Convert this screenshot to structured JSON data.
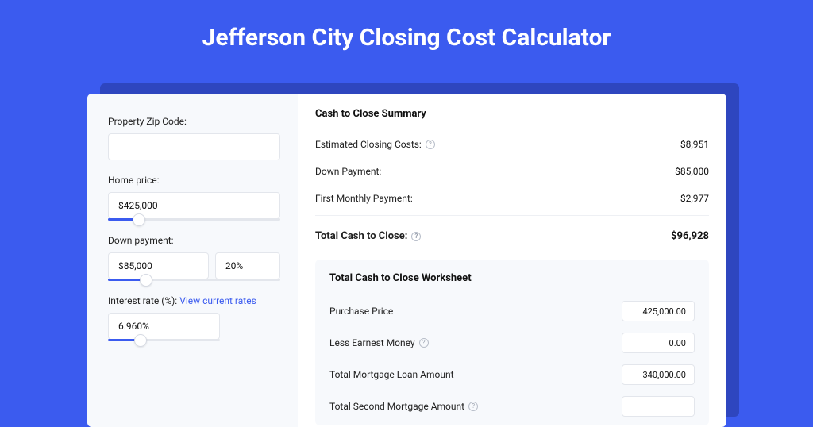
{
  "title": "Jefferson City Closing Cost Calculator",
  "form": {
    "zip_label": "Property Zip Code:",
    "zip_value": "",
    "home_price_label": "Home price:",
    "home_price_value": "$425,000",
    "home_price_slider_pct": 18,
    "down_payment_label": "Down payment:",
    "down_payment_value": "$85,000",
    "down_payment_pct_value": "20%",
    "down_payment_slider_pct": 22,
    "interest_label": "Interest rate (%):",
    "interest_link": "View current rates",
    "interest_value": "6.960%",
    "interest_slider_pct": 29
  },
  "summary": {
    "title": "Cash to Close Summary",
    "rows": {
      "closing_costs_label": "Estimated Closing Costs:",
      "closing_costs_value": "$8,951",
      "down_payment_label": "Down Payment:",
      "down_payment_value": "$85,000",
      "first_payment_label": "First Monthly Payment:",
      "first_payment_value": "$2,977",
      "total_label": "Total Cash to Close:",
      "total_value": "$96,928"
    }
  },
  "worksheet": {
    "title": "Total Cash to Close Worksheet",
    "rows": {
      "purchase_price_label": "Purchase Price",
      "purchase_price_value": "425,000.00",
      "less_earnest_label": "Less Earnest Money",
      "less_earnest_value": "0.00",
      "mortgage_loan_label": "Total Mortgage Loan Amount",
      "mortgage_loan_value": "340,000.00",
      "second_mortgage_label": "Total Second Mortgage Amount"
    }
  }
}
